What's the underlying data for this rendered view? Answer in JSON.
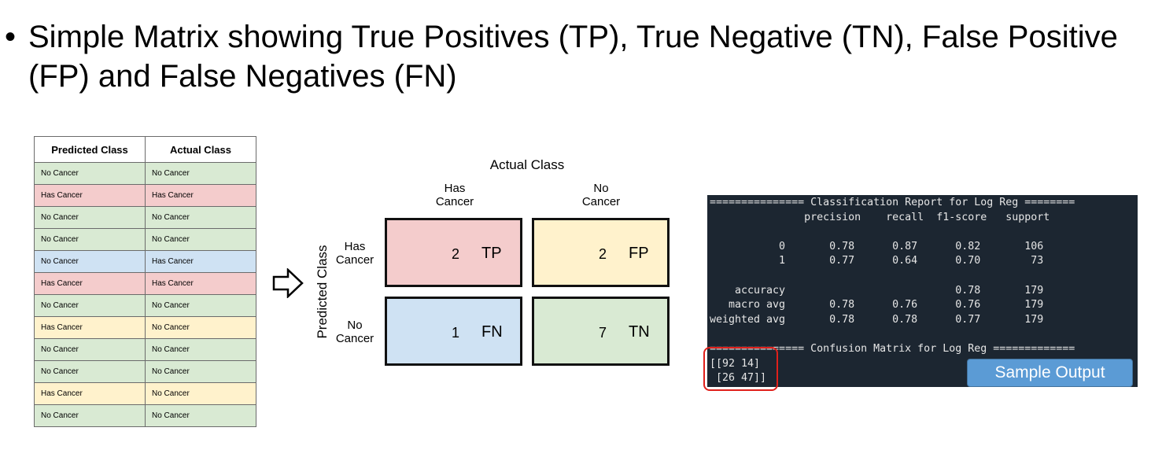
{
  "slide": {
    "bullet": "•",
    "title": "Simple Matrix showing True Positives (TP), True Negative (TN), False Positive (FP) and False Negatives (FN)"
  },
  "table": {
    "headers": [
      "Predicted Class",
      "Actual Class"
    ],
    "rows": [
      {
        "predicted": "No Cancer",
        "actual": "No Cancer",
        "color": "#d9ead3"
      },
      {
        "predicted": "Has Cancer",
        "actual": "Has Cancer",
        "color": "#f4cccc"
      },
      {
        "predicted": "No Cancer",
        "actual": "No Cancer",
        "color": "#d9ead3"
      },
      {
        "predicted": "No Cancer",
        "actual": "No Cancer",
        "color": "#d9ead3"
      },
      {
        "predicted": "No Cancer",
        "actual": "Has Cancer",
        "color": "#cfe2f3"
      },
      {
        "predicted": "Has Cancer",
        "actual": "Has Cancer",
        "color": "#f4cccc"
      },
      {
        "predicted": "No Cancer",
        "actual": "No Cancer",
        "color": "#d9ead3"
      },
      {
        "predicted": "Has Cancer",
        "actual": "No Cancer",
        "color": "#fff2cc"
      },
      {
        "predicted": "No Cancer",
        "actual": "No Cancer",
        "color": "#d9ead3"
      },
      {
        "predicted": "No Cancer",
        "actual": "No Cancer",
        "color": "#d9ead3"
      },
      {
        "predicted": "Has Cancer",
        "actual": "No Cancer",
        "color": "#fff2cc"
      },
      {
        "predicted": "No Cancer",
        "actual": "No Cancer",
        "color": "#d9ead3"
      }
    ]
  },
  "matrix": {
    "actual_label": "Actual Class",
    "predicted_label": "Predicted Class",
    "col_has": [
      "Has",
      "Cancer"
    ],
    "col_no": [
      "No",
      "Cancer"
    ],
    "row_has": [
      "Has",
      "Cancer"
    ],
    "row_no": [
      "No",
      "Cancer"
    ],
    "tp": {
      "value": "2",
      "label": "TP"
    },
    "fp": {
      "value": "2",
      "label": "FP"
    },
    "fn": {
      "value": "1",
      "label": "FN"
    },
    "tn": {
      "value": "7",
      "label": "TN"
    }
  },
  "terminal": {
    "lines": [
      "=============== Classification Report for Log Reg ========",
      "               precision    recall  f1-score   support",
      "",
      "           0       0.78      0.87      0.82       106",
      "           1       0.77      0.64      0.70        73",
      "",
      "    accuracy                           0.78       179",
      "   macro avg       0.78      0.76      0.76       179",
      "weighted avg       0.78      0.78      0.77       179",
      "",
      "=============== Confusion Matrix for Log Reg =============",
      "[[92 14]",
      " [26 47]]"
    ],
    "button_label": "Sample Output"
  },
  "colors": {
    "green": "#d9ead3",
    "red": "#f4cccc",
    "blue": "#cfe2f3",
    "yellow": "#fff2cc",
    "terminal_bg": "#1c2631",
    "highlight": "#e0201b",
    "button": "#5b9bd5"
  }
}
